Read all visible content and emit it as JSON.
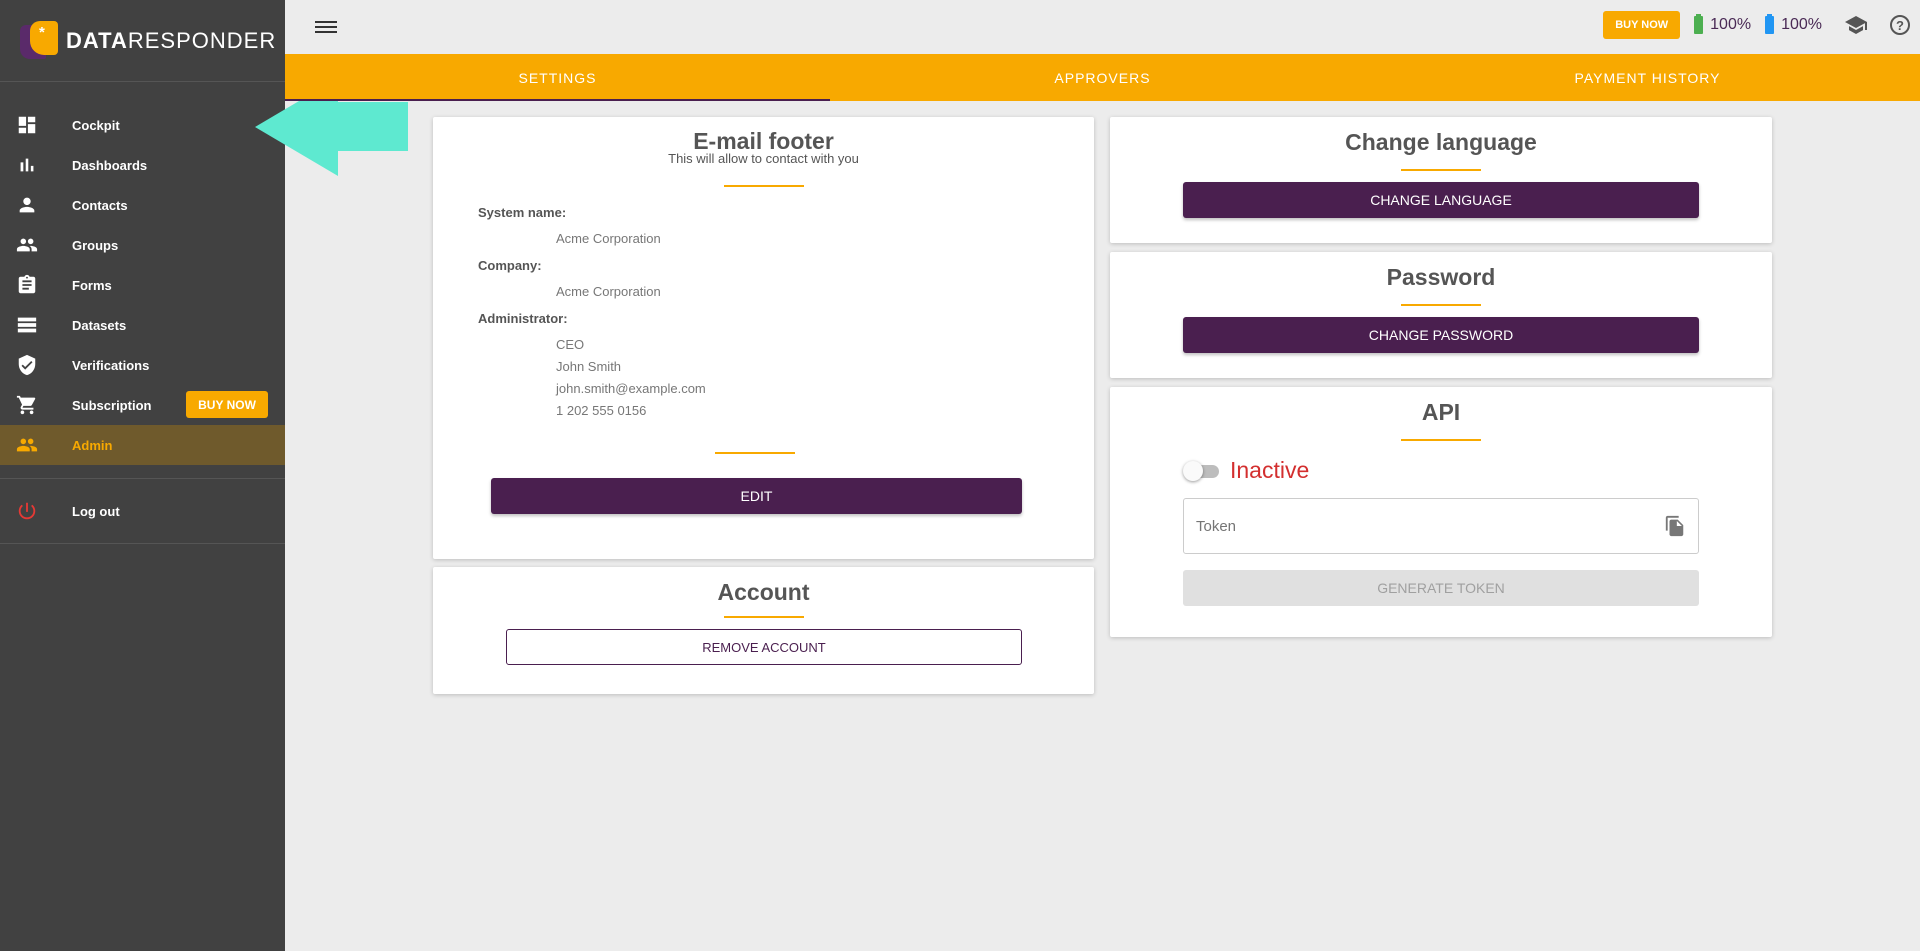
{
  "logo": {
    "brand_bold": "DATA",
    "brand_rest": "RESPONDER"
  },
  "sidebar": {
    "items": [
      {
        "label": "Cockpit",
        "icon": "dashboard-icon"
      },
      {
        "label": "Dashboards",
        "icon": "bar-chart-icon"
      },
      {
        "label": "Contacts",
        "icon": "person-icon"
      },
      {
        "label": "Groups",
        "icon": "people-icon"
      },
      {
        "label": "Forms",
        "icon": "clipboard-icon"
      },
      {
        "label": "Datasets",
        "icon": "list-icon"
      },
      {
        "label": "Verifications",
        "icon": "shield-check-icon"
      },
      {
        "label": "Subscription",
        "icon": "cart-icon",
        "badge": "BUY NOW"
      },
      {
        "label": "Admin",
        "icon": "admin-people-icon",
        "active": true
      }
    ],
    "logout": "Log out"
  },
  "topbar": {
    "buy_now": "BUY NOW",
    "battery_green": "100%",
    "battery_blue": "100%"
  },
  "tabs": [
    {
      "label": "SETTINGS",
      "active": true
    },
    {
      "label": "APPROVERS"
    },
    {
      "label": "PAYMENT HISTORY"
    }
  ],
  "email_footer": {
    "title": "E-mail footer",
    "subtitle": "This will allow to contact with you",
    "system_name_label": "System name:",
    "system_name": "Acme Corporation",
    "company_label": "Company:",
    "company": "Acme Corporation",
    "administrator_label": "Administrator:",
    "admin_title": "CEO",
    "admin_name": "John Smith",
    "admin_email": "john.smith@example.com",
    "admin_phone": "1 202 555 0156",
    "edit_button": "EDIT"
  },
  "account": {
    "title": "Account",
    "remove_button": "REMOVE ACCOUNT"
  },
  "language": {
    "title": "Change language",
    "button": "CHANGE LANGUAGE"
  },
  "password": {
    "title": "Password",
    "button": "CHANGE PASSWORD"
  },
  "api": {
    "title": "API",
    "status": "Inactive",
    "token_placeholder": "Token",
    "generate_button": "GENERATE TOKEN"
  },
  "colors": {
    "accent": "#f8a900",
    "primary": "#4a1f4f",
    "sidebar": "#414141",
    "inactive": "#d32f2f",
    "arrow": "#5ee9d0"
  }
}
